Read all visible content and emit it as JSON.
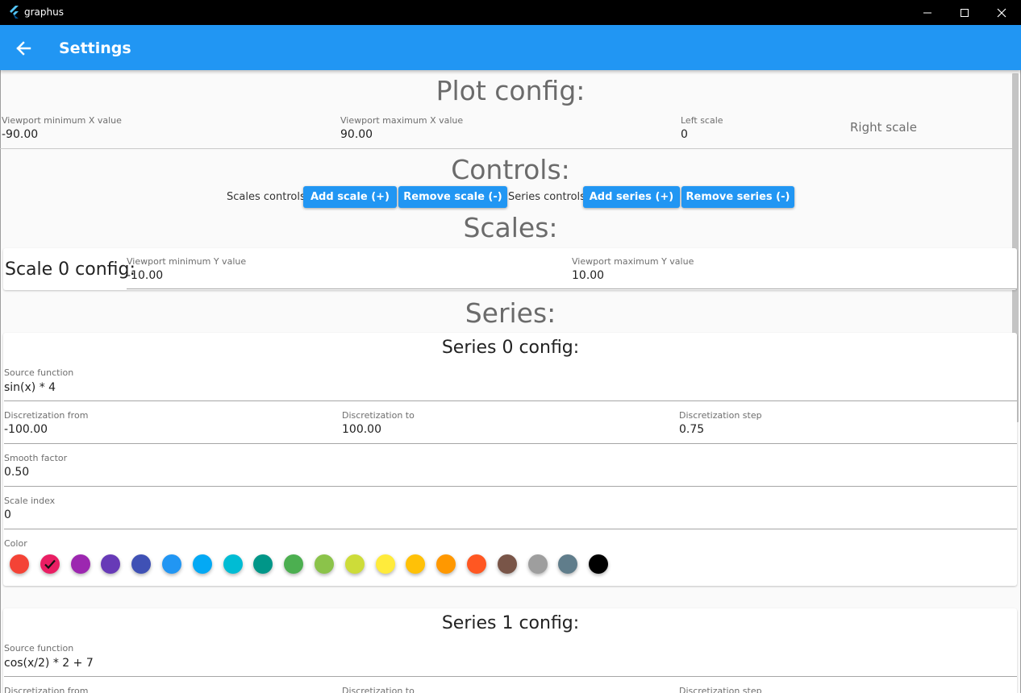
{
  "window": {
    "title": "graphus"
  },
  "appbar": {
    "title": "Settings"
  },
  "plot_config": {
    "heading": "Plot config:",
    "viewport_min_x": {
      "label": "Viewport minimum X value",
      "value": "-90.00"
    },
    "viewport_max_x": {
      "label": "Viewport maximum X value",
      "value": "90.00"
    },
    "left_scale": {
      "label": "Left scale",
      "value": "0"
    },
    "right_scale": {
      "label": "Right scale"
    }
  },
  "controls": {
    "heading": "Controls:",
    "scales_label": "Scales controls:",
    "add_scale": "Add scale (+)",
    "remove_scale": "Remove scale (-)",
    "series_label": "Series controls:",
    "add_series": "Add series (+)",
    "remove_series": "Remove series (-)"
  },
  "scales": {
    "heading": "Scales:",
    "items": [
      {
        "title": "Scale 0 config:",
        "min_y": {
          "label": "Viewport minimum Y value",
          "value": "-10.00"
        },
        "max_y": {
          "label": "Viewport maximum Y value",
          "value": "10.00"
        }
      }
    ]
  },
  "series": {
    "heading": "Series:",
    "items": [
      {
        "title": "Series 0 config:",
        "source_function": {
          "label": "Source function",
          "value": "sin(x) * 4"
        },
        "discretization_from": {
          "label": "Discretization from",
          "value": "-100.00"
        },
        "discretization_to": {
          "label": "Discretization to",
          "value": "100.00"
        },
        "discretization_step": {
          "label": "Discretization step",
          "value": "0.75"
        },
        "smooth_factor": {
          "label": "Smooth factor",
          "value": "0.50"
        },
        "scale_index": {
          "label": "Scale index",
          "value": "0"
        },
        "color": {
          "label": "Color",
          "selected_index": 1,
          "palette": [
            "#f44336",
            "#e91e63",
            "#9c27b0",
            "#673ab7",
            "#3f51b5",
            "#2196f3",
            "#03a9f4",
            "#00bcd4",
            "#009688",
            "#4caf50",
            "#8bc34a",
            "#cddc39",
            "#ffeb3b",
            "#ffc107",
            "#ff9800",
            "#ff5722",
            "#795548",
            "#9e9e9e",
            "#607d8b",
            "#000000"
          ]
        }
      },
      {
        "title": "Series 1 config:",
        "source_function": {
          "label": "Source function",
          "value": "cos(x/2) * 2 + 7"
        },
        "discretization_from": {
          "label": "Discretization from"
        },
        "discretization_to": {
          "label": "Discretization to"
        },
        "discretization_step": {
          "label": "Discretization step"
        }
      }
    ]
  },
  "colors": {
    "accent": "#2196f3",
    "titlebar": "#000000",
    "heading_text": "#6b6b6b"
  }
}
